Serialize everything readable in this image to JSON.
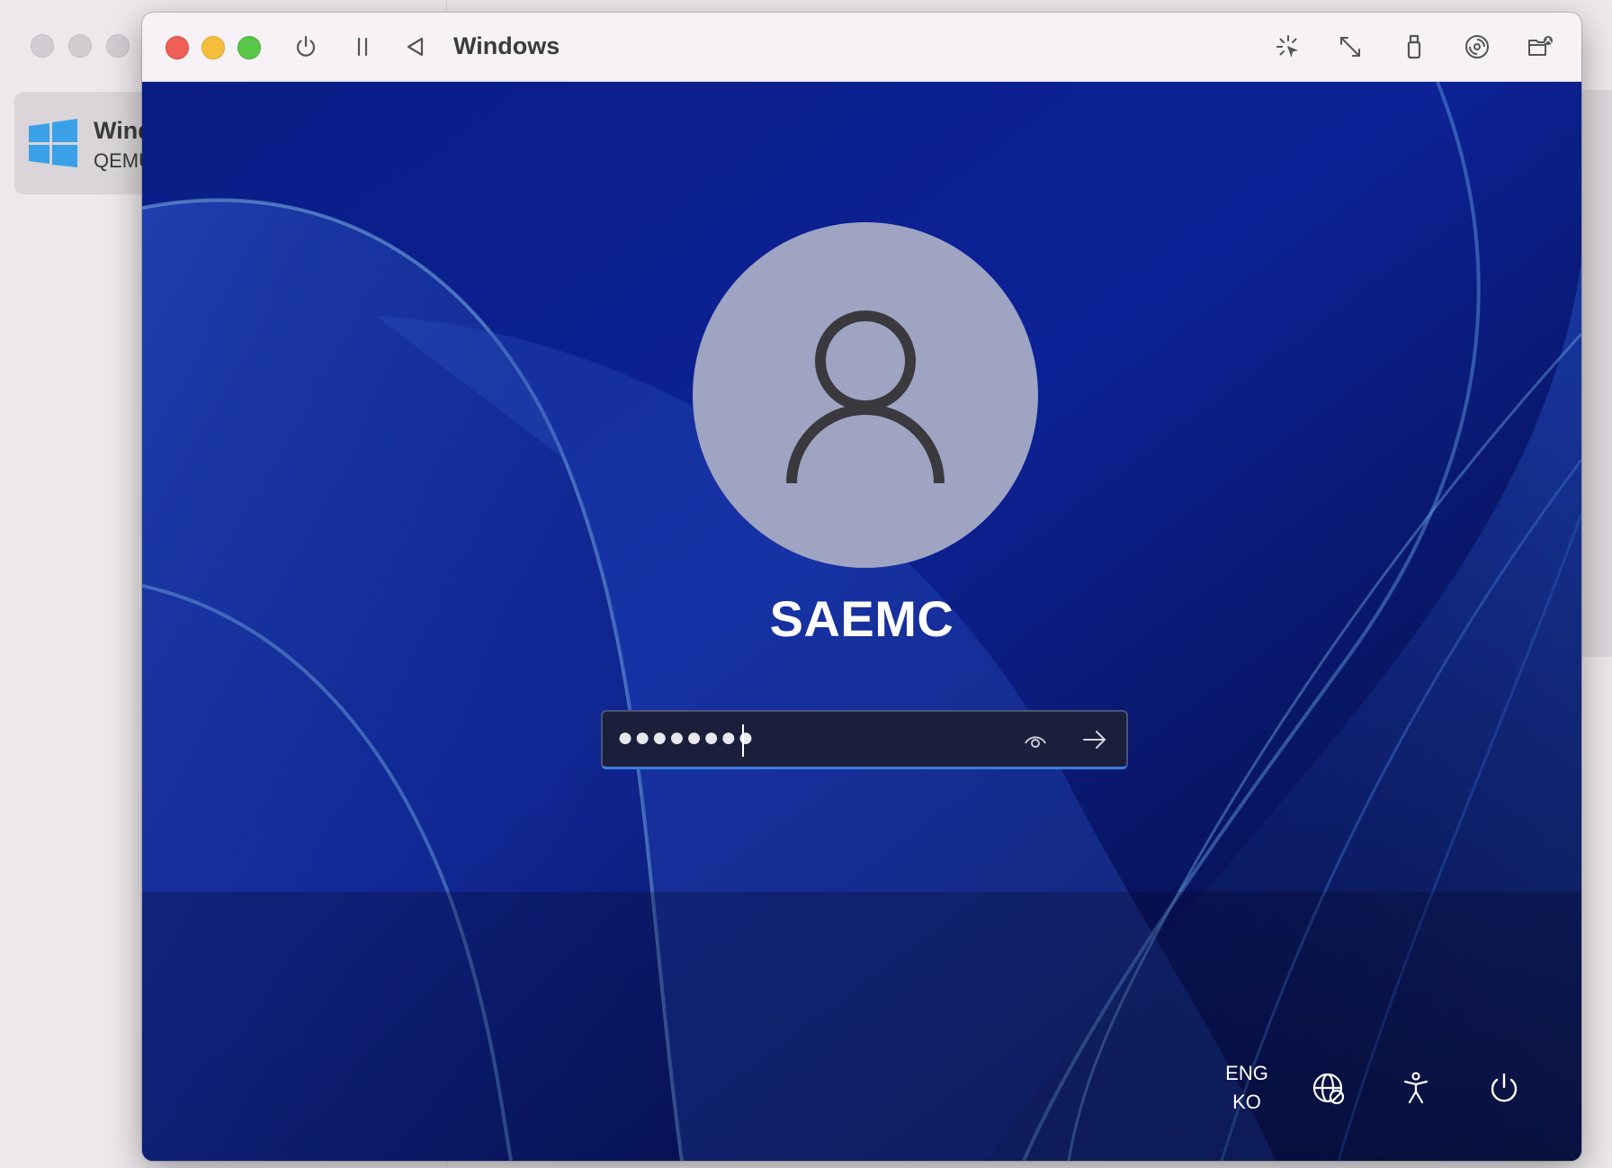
{
  "background_app": {
    "vm_list": [
      {
        "title": "Wind",
        "subtitle": "QEMU"
      }
    ]
  },
  "window": {
    "title": "Windows",
    "toolbar_icons": [
      "power-icon",
      "pause-icon",
      "back-icon",
      "cursor-capture-icon",
      "resize-icon",
      "usb-icon",
      "disc-icon",
      "shared-folder-icon"
    ]
  },
  "lockscreen": {
    "username": "SAEMC",
    "password_masked": "●●●●●●●●",
    "language_line1": "ENG",
    "language_line2": "KO",
    "tray_icons": [
      "network-icon",
      "accessibility-icon",
      "power-icon"
    ]
  },
  "colors": {
    "close": "#ee5f58",
    "minimize": "#f5bd3c",
    "maximize": "#5ac64a",
    "wallpaper": "#0c1a7a",
    "accent_underline": "#3c7ce0"
  }
}
